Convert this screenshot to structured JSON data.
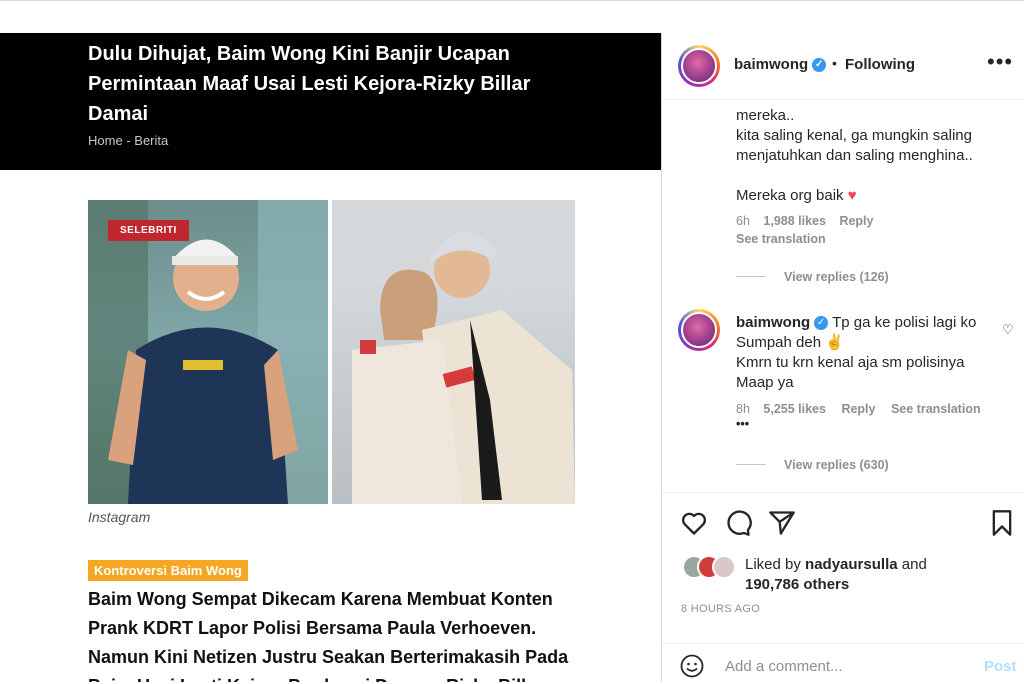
{
  "article": {
    "title": "Dulu Dihujat, Baim Wong Kini Banjir Ucapan Permintaan Maaf Usai Lesti Kejora-Rizky Billar Damai",
    "breadcrumb": [
      "Home",
      "-",
      "Berita"
    ],
    "badge": "SELEBRITI",
    "photo_caption": "Instagram",
    "tag": "Kontroversi Baim Wong",
    "lede": "Baim Wong Sempat Dikecam Karena Membuat Konten Prank KDRT Lapor Polisi Bersama Paula Verhoeven. Namun Kini Netizen Justru Seakan Berterimakasih Pada Baim Usai Lesti Kejora Berdamai Dengan Rizky Billar"
  },
  "header": {
    "username": "baimwong",
    "separator": "•",
    "following_label": "Following",
    "more_label": "•••"
  },
  "comments": [
    {
      "lines": [
        "mereka..",
        "kita saling kenal, ga mungkin saling",
        "menjatuhkan dan saling menghina..",
        "",
        "Mereka org baik"
      ],
      "time": "6h",
      "likes": "1,988 likes",
      "reply": "Reply",
      "see_translation": "See translation",
      "view_replies": "View replies (126)"
    },
    {
      "username": "baimwong",
      "lines": [
        "Tp ga ke polisi lagi ko",
        "Sumpah deh",
        "Kmrn tu krn kenal aja sm polisinya",
        "Maap ya"
      ],
      "time": "8h",
      "likes": "5,255 likes",
      "reply": "Reply",
      "see_translation": "See translation",
      "more": "•••",
      "view_replies": "View replies (630)"
    }
  ],
  "actions": {
    "liked_by_prefix": "Liked by",
    "liked_by_user": "nadyaursulla",
    "liked_by_and": "and",
    "liked_by_others": "190,786 others",
    "time_ago": "8 HOURS AGO",
    "comment_placeholder": "Add a comment...",
    "post_label": "Post"
  },
  "colors": {
    "accent_blue": "#3897f0",
    "post_disabled": "#b2dffc",
    "heart_red": "#ed4956",
    "badge_red": "#c0262d",
    "tag_orange": "#f5a623"
  }
}
